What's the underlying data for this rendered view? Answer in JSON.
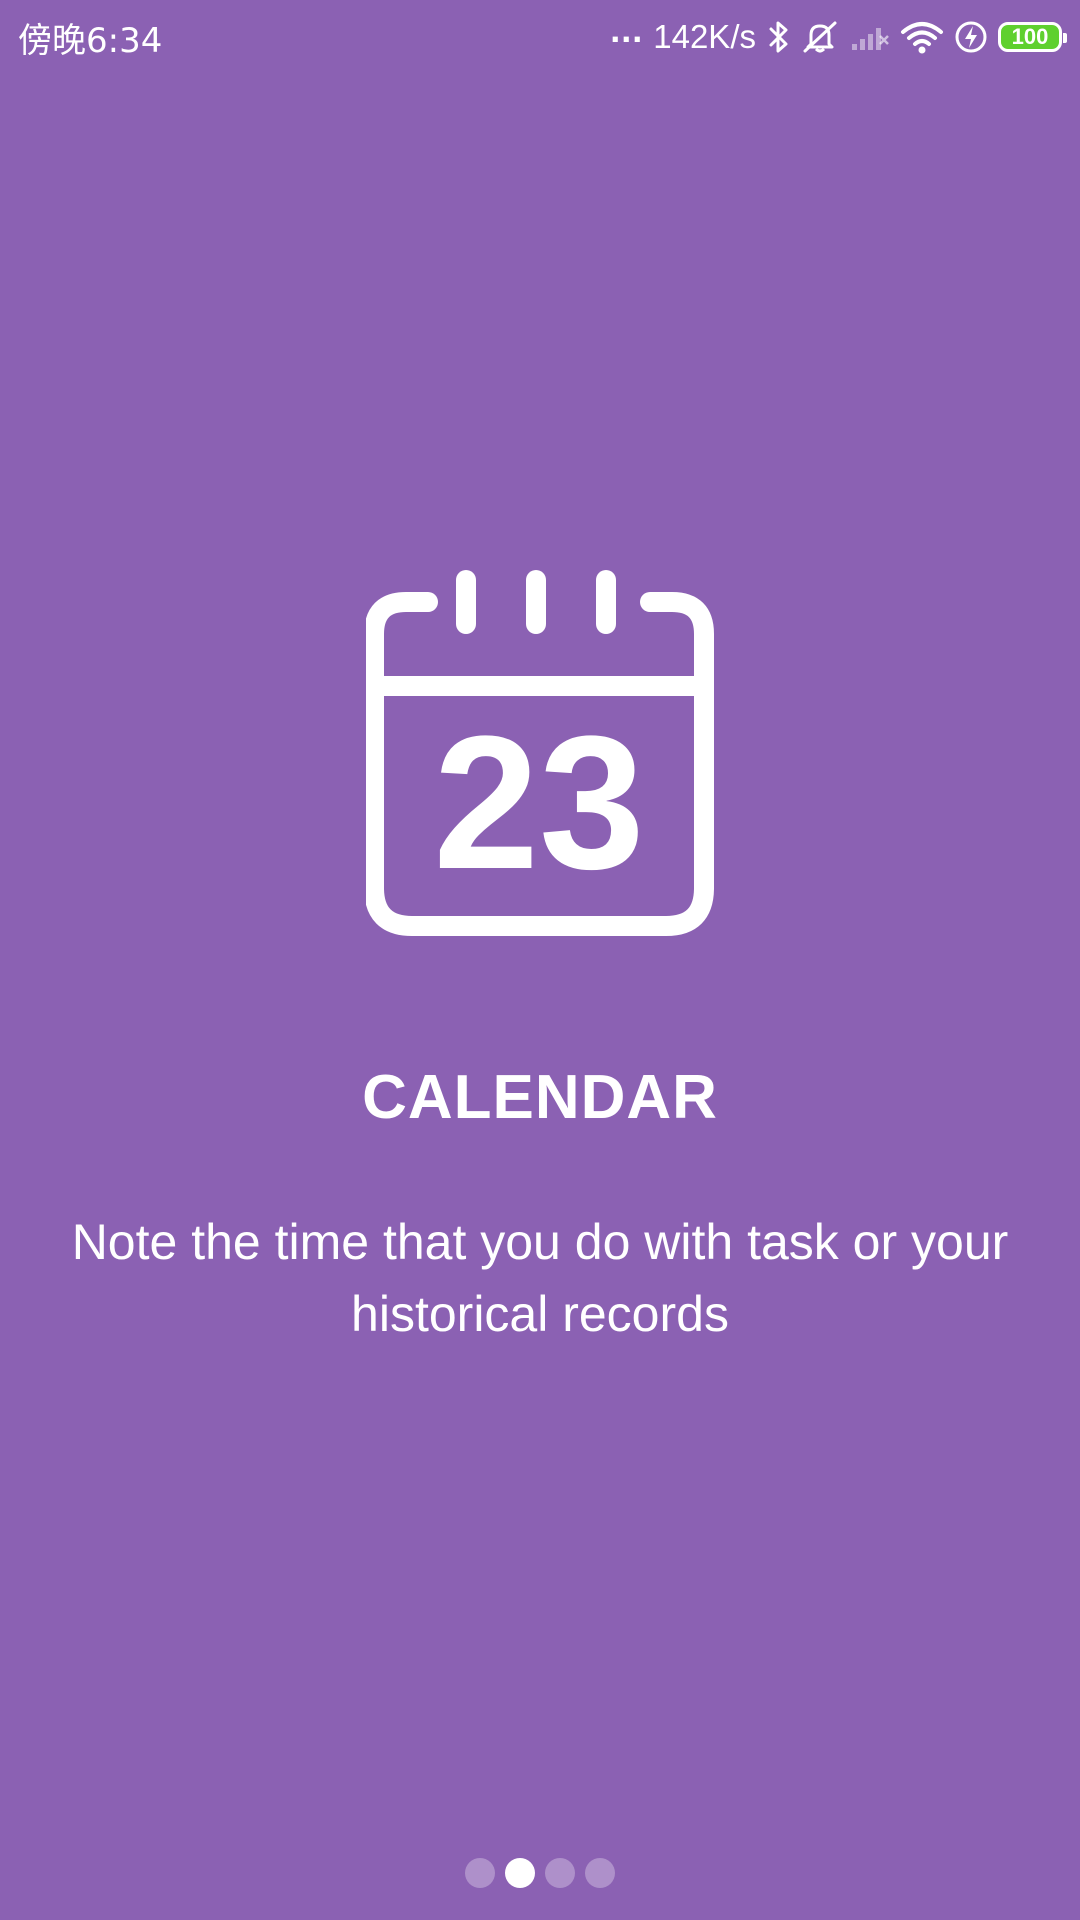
{
  "status_bar": {
    "time": "傍晚6:34",
    "more": "...",
    "net_speed": "142K/s",
    "battery": "100",
    "icons": [
      "bluetooth-icon",
      "mute-icon",
      "signal-icon",
      "wifi-icon",
      "charging-icon",
      "battery-icon"
    ]
  },
  "onboarding": {
    "icon": "calendar-icon",
    "icon_day": "23",
    "title": "CALENDAR",
    "description": "Note the time that you do with task or your historical records",
    "page_indicator": {
      "total": 4,
      "current": 2
    }
  },
  "colors": {
    "background": "#8b61b3",
    "foreground": "#ffffff",
    "battery": "#5fd02f"
  }
}
